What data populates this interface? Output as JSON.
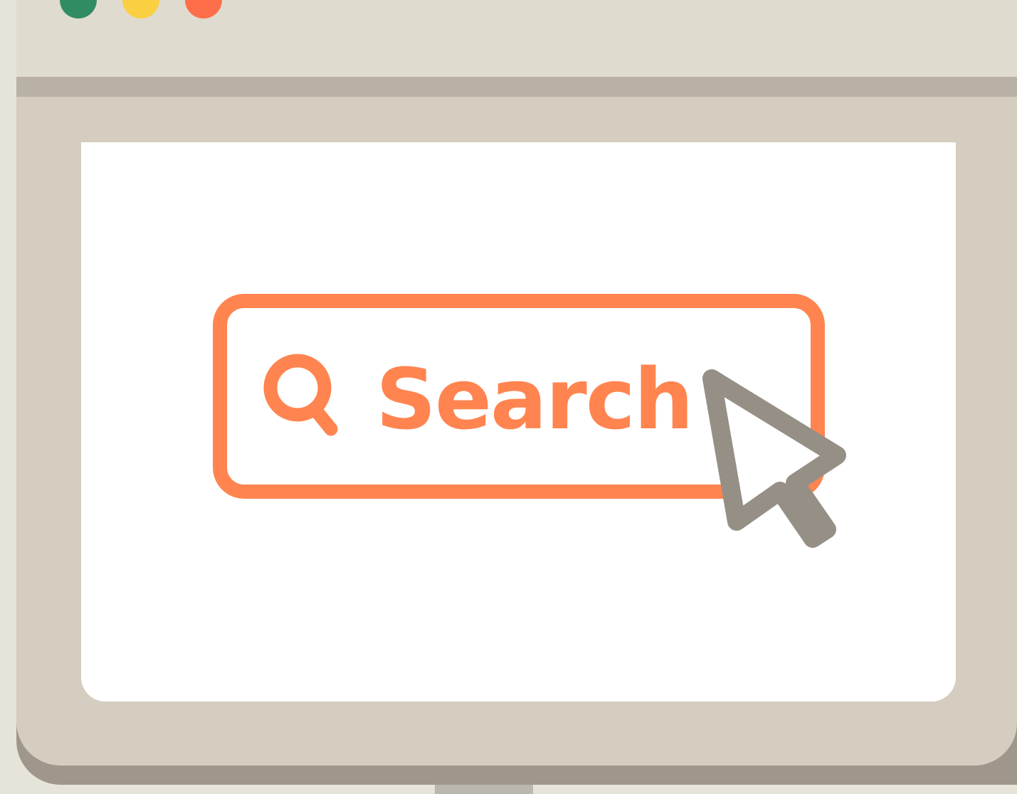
{
  "window": {
    "traffic_lights": [
      {
        "name": "close",
        "color": "#328c63"
      },
      {
        "name": "minimize",
        "color": "#fad042"
      },
      {
        "name": "zoom",
        "color": "#ff6e4a"
      }
    ],
    "frame_color": "#d5cdbf",
    "title_bar_color": "#dfdbcf"
  },
  "search": {
    "label": "Search",
    "icon": "magnifier-icon",
    "accent_color": "#ff8450"
  },
  "pointer": {
    "icon": "cursor-arrow-icon",
    "color": "#958f86"
  }
}
